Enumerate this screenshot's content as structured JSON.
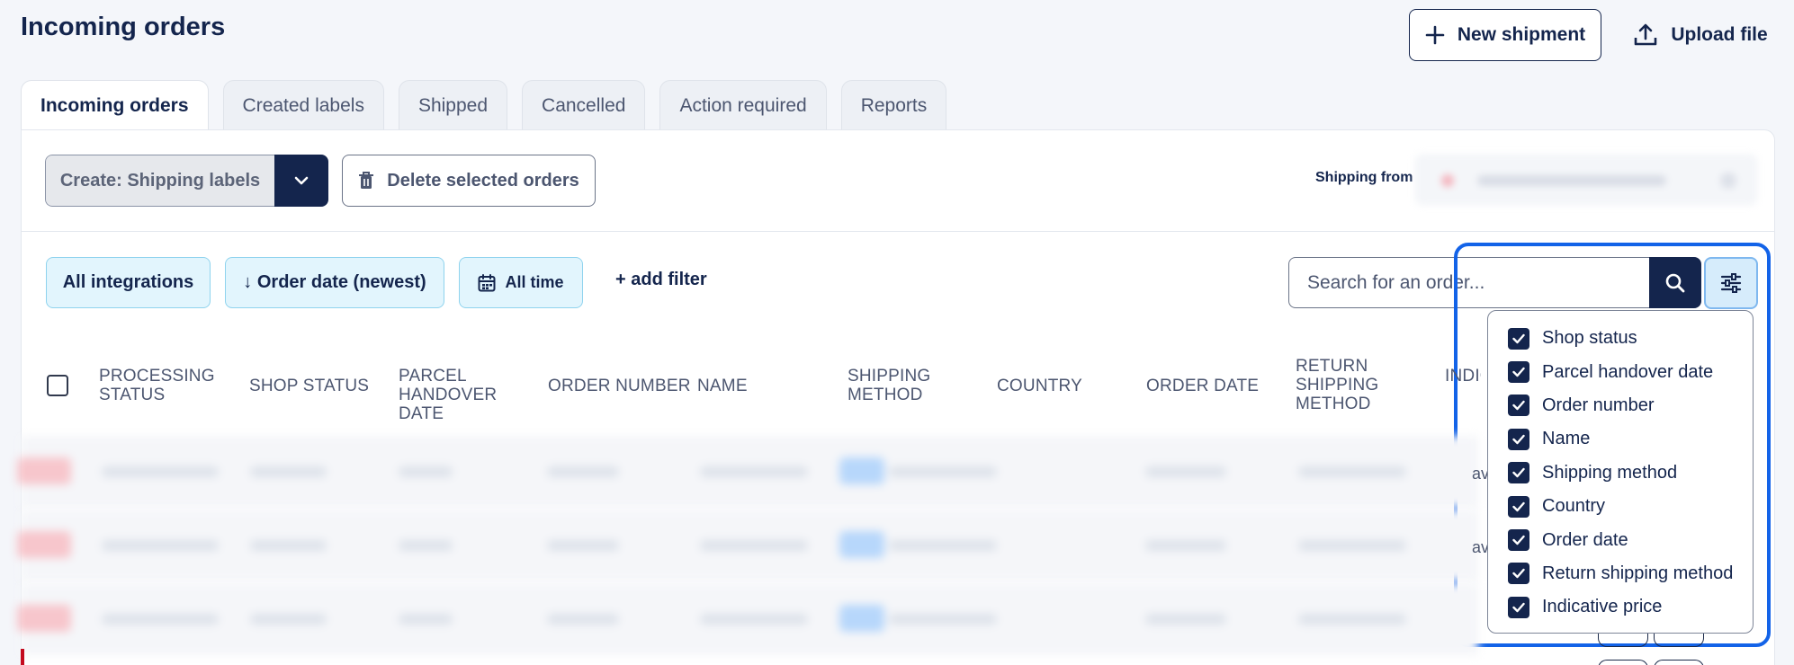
{
  "page": {
    "title": "Incoming orders"
  },
  "header": {
    "new_shipment": "New shipment",
    "upload_file": "Upload file"
  },
  "tabs": [
    {
      "label": "Incoming orders",
      "active": true
    },
    {
      "label": "Created labels"
    },
    {
      "label": "Shipped"
    },
    {
      "label": "Cancelled"
    },
    {
      "label": "Action required"
    },
    {
      "label": "Reports"
    }
  ],
  "toolbar": {
    "create_label": "Create: Shipping labels",
    "delete_label": "Delete selected orders",
    "shipping_from_label": "Shipping from"
  },
  "filters": {
    "integrations": "All integrations",
    "sort": "↓ Order date (newest)",
    "time": "All time",
    "add_filter": "+ add filter"
  },
  "search": {
    "placeholder": "Search for an order..."
  },
  "table": {
    "columns": [
      "Processing status",
      "Shop status",
      "Parcel handover date",
      "Order number",
      "Name",
      "Shipping method",
      "Country",
      "Order date",
      "Return shipping method",
      "Indic... pric..."
    ],
    "partial_cells": [
      "av",
      "av"
    ]
  },
  "column_menu": {
    "items": [
      {
        "label": "Shop status",
        "checked": true
      },
      {
        "label": "Parcel handover date",
        "checked": true
      },
      {
        "label": "Order number",
        "checked": true
      },
      {
        "label": "Name",
        "checked": true
      },
      {
        "label": "Shipping method",
        "checked": true
      },
      {
        "label": "Country",
        "checked": true
      },
      {
        "label": "Order date",
        "checked": true
      },
      {
        "label": "Return shipping method",
        "checked": true
      },
      {
        "label": "Indicative price",
        "checked": true
      }
    ]
  },
  "colors": {
    "primary": "#14254d",
    "chip_bg": "#e2f5fd",
    "chip_border": "#8fd3ee",
    "highlight": "#1363e8"
  },
  "icons": {
    "new_shipment": "plus-icon",
    "upload": "upload-icon",
    "caret": "chevron-down-icon",
    "delete": "trash-icon",
    "calendar": "calendar-icon",
    "search": "search-icon",
    "settings": "sliders-icon",
    "check": "check-icon"
  }
}
